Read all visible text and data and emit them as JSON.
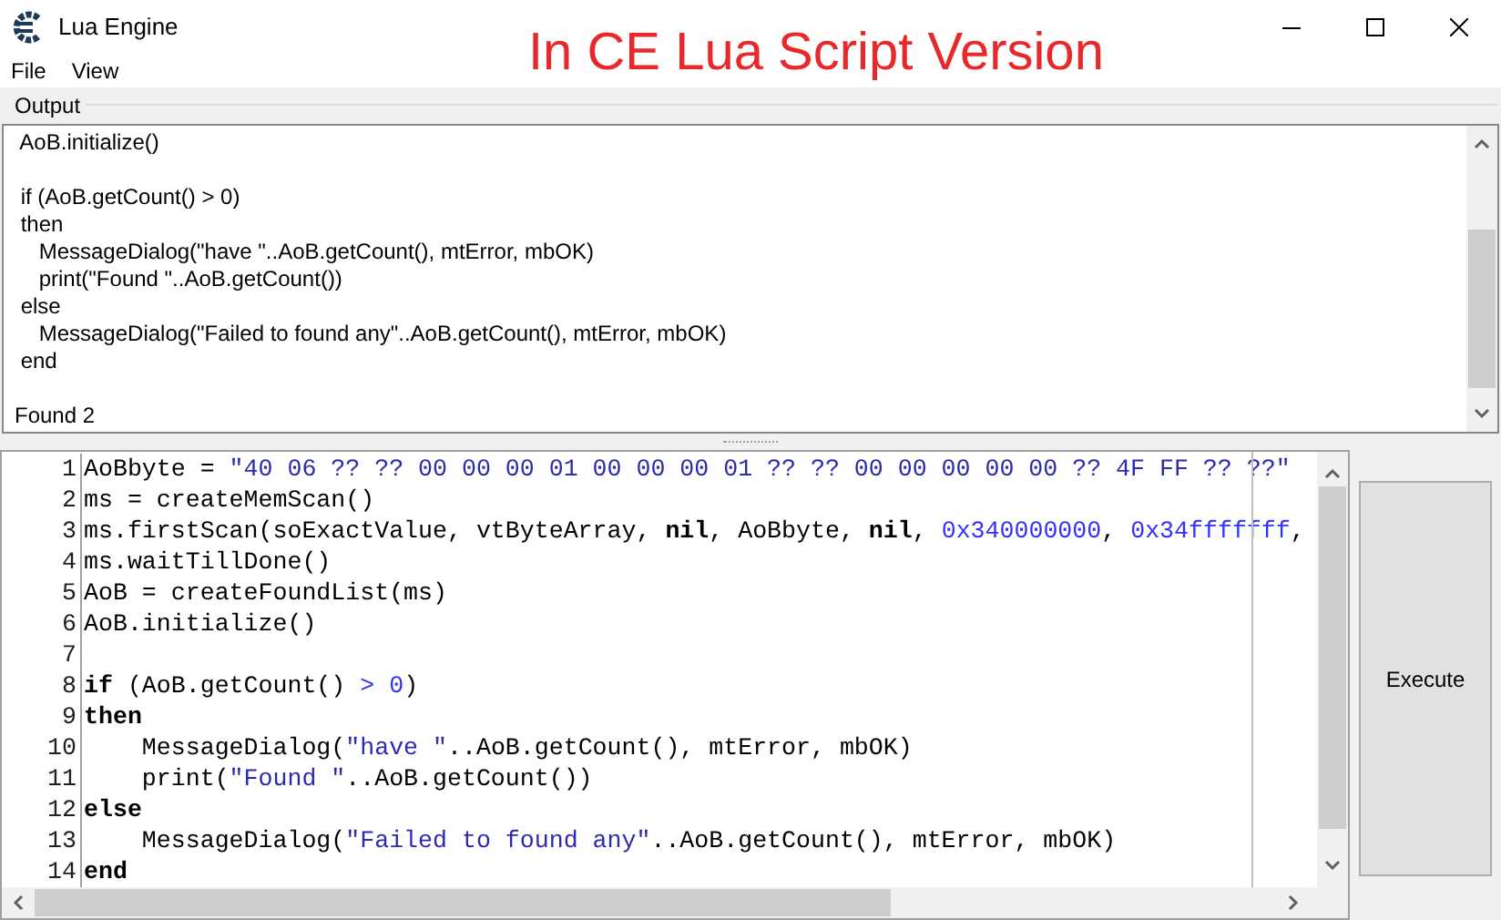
{
  "window": {
    "title": "Lua Engine"
  },
  "annotation": "In CE Lua Script Version",
  "menu": [
    "File",
    "View"
  ],
  "output": {
    "label": "Output",
    "lines": [
      {
        "kind": "text",
        "text": " AoB.initialize()"
      },
      {
        "kind": "blank"
      },
      {
        "kind": "text",
        "text": " if (AoB.getCount() > 0)"
      },
      {
        "kind": "text",
        "text": " then"
      },
      {
        "kind": "text",
        "text": "    MessageDialog(\"have \"..AoB.getCount(), mtError, mbOK)"
      },
      {
        "kind": "text",
        "text": "    print(\"Found \"..AoB.getCount())"
      },
      {
        "kind": "text",
        "text": " else"
      },
      {
        "kind": "text",
        "text": "    MessageDialog(\"Failed to found any\"..AoB.getCount(), mtError, mbOK)"
      },
      {
        "kind": "text",
        "text": " end"
      },
      {
        "kind": "blank"
      },
      {
        "kind": "text",
        "text": "Found 2"
      }
    ]
  },
  "editor": {
    "lines": [
      {
        "number": "1",
        "segments": [
          {
            "kind": "plain",
            "text": "AoBbyte = "
          },
          {
            "kind": "string",
            "text": "\"40 06 ?? ?? 00 00 00 01 00 00 00 01 ?? ?? 00 00 00 00 00 ?? 4F FF ?? ??\""
          }
        ]
      },
      {
        "number": "2",
        "segments": [
          {
            "kind": "plain",
            "text": "ms = createMemScan()"
          }
        ]
      },
      {
        "number": "3",
        "segments": [
          {
            "kind": "plain",
            "text": "ms.firstScan(soExactValue, vtByteArray, "
          },
          {
            "kind": "keyword",
            "text": "nil"
          },
          {
            "kind": "plain",
            "text": ", AoBbyte, "
          },
          {
            "kind": "keyword",
            "text": "nil"
          },
          {
            "kind": "plain",
            "text": ", "
          },
          {
            "kind": "number",
            "text": "0x340000000"
          },
          {
            "kind": "plain",
            "text": ", "
          },
          {
            "kind": "number",
            "text": "0x34fffffff"
          },
          {
            "kind": "plain",
            "text": ","
          }
        ]
      },
      {
        "number": "4",
        "segments": [
          {
            "kind": "plain",
            "text": "ms.waitTillDone()"
          }
        ]
      },
      {
        "number": "5",
        "segments": [
          {
            "kind": "plain",
            "text": "AoB = createFoundList(ms)"
          }
        ]
      },
      {
        "number": "6",
        "segments": [
          {
            "kind": "plain",
            "text": "AoB.initialize()"
          }
        ]
      },
      {
        "number": "7"
      },
      {
        "number": "8",
        "segments": [
          {
            "kind": "keyword",
            "text": "if"
          },
          {
            "kind": "plain",
            "text": " (AoB.getCount() "
          },
          {
            "kind": "symbol",
            "text": "> "
          },
          {
            "kind": "number",
            "text": "0"
          },
          {
            "kind": "plain",
            "text": ")"
          }
        ]
      },
      {
        "number": "9",
        "segments": [
          {
            "kind": "keyword",
            "text": "then"
          }
        ]
      },
      {
        "number": "10",
        "segments": [
          {
            "kind": "plain",
            "text": "    MessageDialog("
          },
          {
            "kind": "string",
            "text": "\"have \""
          },
          {
            "kind": "plain",
            "text": "..AoB.getCount(), mtError, mbOK)"
          }
        ]
      },
      {
        "number": "11",
        "segments": [
          {
            "kind": "plain",
            "text": "    print("
          },
          {
            "kind": "string",
            "text": "\"Found \""
          },
          {
            "kind": "plain",
            "text": "..AoB.getCount())"
          }
        ]
      },
      {
        "number": "12",
        "segments": [
          {
            "kind": "keyword",
            "text": "else"
          }
        ]
      },
      {
        "number": "13",
        "segments": [
          {
            "kind": "plain",
            "text": "    MessageDialog("
          },
          {
            "kind": "string",
            "text": "\"Failed to found any\""
          },
          {
            "kind": "plain",
            "text": "..AoB.getCount(), mtError, mbOK)"
          }
        ]
      },
      {
        "number": "14",
        "segments": [
          {
            "kind": "keyword",
            "text": "end"
          }
        ]
      }
    ]
  },
  "execute_button": "Execute"
}
